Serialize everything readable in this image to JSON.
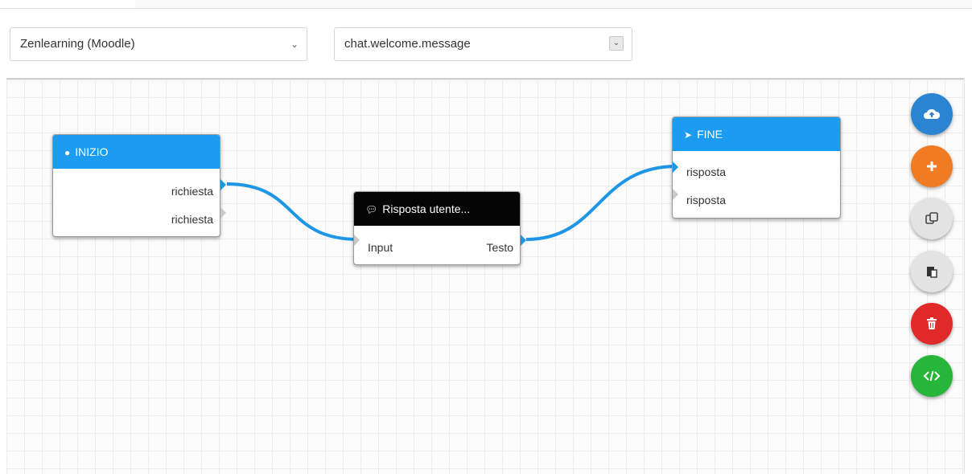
{
  "toolbar": {
    "project_select": {
      "value": "Zenlearning (Moodle)"
    },
    "message_select": {
      "value": "chat.welcome.message"
    }
  },
  "nodes": {
    "start": {
      "title": "INIZIO",
      "outputs": [
        "richiesta",
        "richiesta"
      ]
    },
    "reply": {
      "title": "Risposta utente...",
      "input": "Input",
      "output": "Testo"
    },
    "end": {
      "title": "FINE",
      "inputs": [
        "risposta",
        "risposta"
      ]
    }
  },
  "actions": [
    {
      "name": "upload",
      "icon": "cloud-upload-icon",
      "color": "#2a84d2"
    },
    {
      "name": "add",
      "icon": "plus-icon",
      "color": "#f07b22"
    },
    {
      "name": "copy",
      "icon": "copy-icon",
      "color": "#e3e3e3"
    },
    {
      "name": "paste",
      "icon": "paste-icon",
      "color": "#e3e3e3"
    },
    {
      "name": "delete",
      "icon": "trash-icon",
      "color": "#e02a2a"
    },
    {
      "name": "code",
      "icon": "code-icon",
      "color": "#27b53a"
    }
  ],
  "colors": {
    "header_blue": "#1c9cf0",
    "header_black": "#050505",
    "wire": "#1e96e6"
  }
}
